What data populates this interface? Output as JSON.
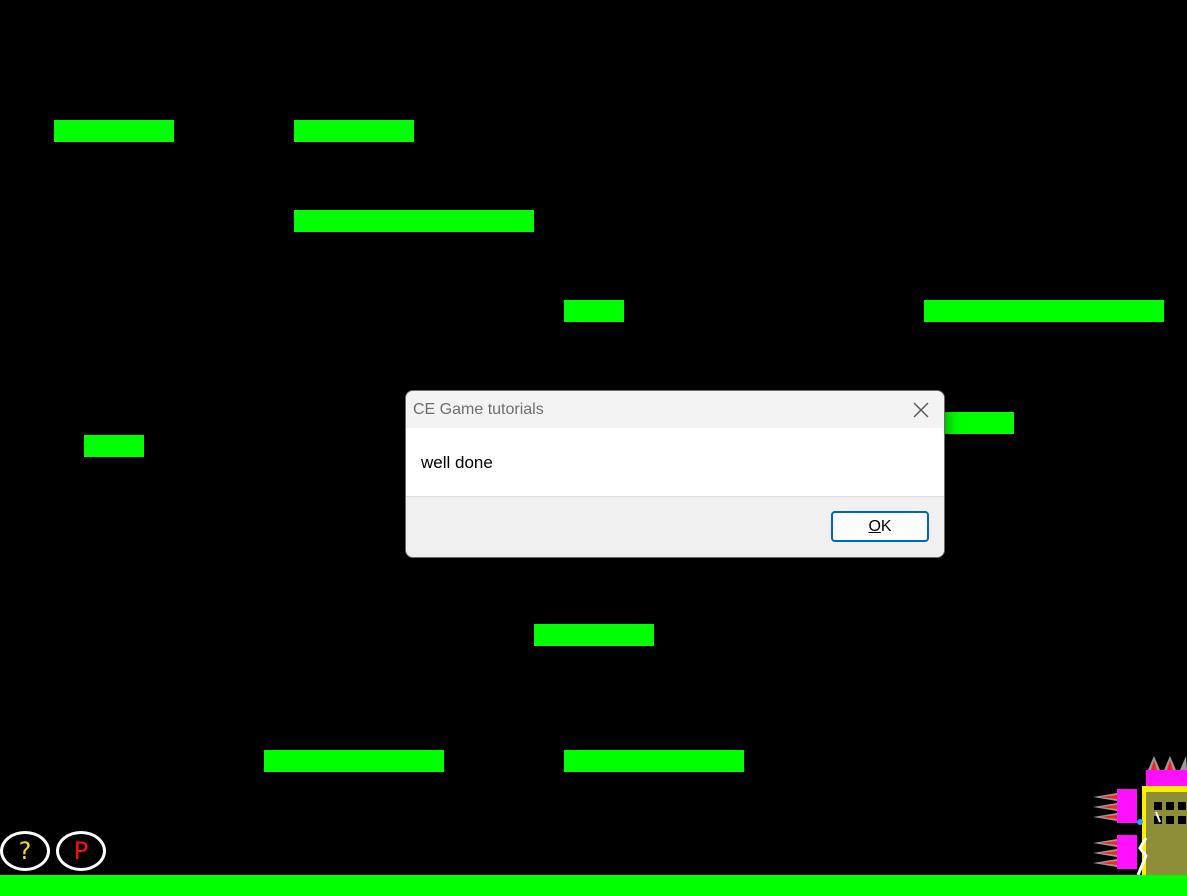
{
  "colors": {
    "background": "#000000",
    "platform": "#00ff00",
    "help_icon": "#ffdd00",
    "pause_icon": "#ff1010",
    "dialog_accent": "#0067c0"
  },
  "platforms": [
    {
      "id": "platform-1"
    },
    {
      "id": "platform-2"
    },
    {
      "id": "platform-3"
    },
    {
      "id": "platform-4"
    },
    {
      "id": "platform-5"
    },
    {
      "id": "platform-6"
    },
    {
      "id": "platform-7"
    },
    {
      "id": "platform-8"
    },
    {
      "id": "platform-9"
    },
    {
      "id": "platform-10"
    }
  ],
  "hud": {
    "help_label": "?",
    "pause_label": "P"
  },
  "dialog": {
    "title": "CE Game tutorials",
    "message": "well done",
    "ok_label_mnemonic": "O",
    "ok_label_rest": "K",
    "close_icon": "close-icon"
  }
}
